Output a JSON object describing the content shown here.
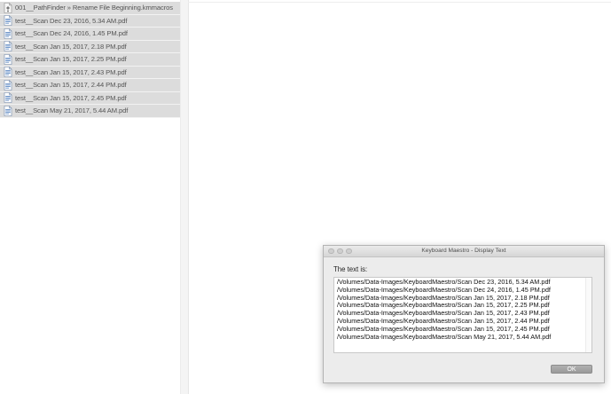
{
  "file_list": {
    "items": [
      {
        "name": "001__PathFinder » Rename File Beginning.kmmacros",
        "icon": "macro-file-icon"
      },
      {
        "name": "test__Scan Dec 23, 2016, 5.34 AM.pdf",
        "icon": "pdf-file-icon"
      },
      {
        "name": "test__Scan Dec 24, 2016, 1.45 PM.pdf",
        "icon": "pdf-file-icon"
      },
      {
        "name": "test__Scan Jan 15, 2017, 2.18 PM.pdf",
        "icon": "pdf-file-icon"
      },
      {
        "name": "test__Scan Jan 15, 2017, 2.25 PM.pdf",
        "icon": "pdf-file-icon"
      },
      {
        "name": "test__Scan Jan 15, 2017, 2.43 PM.pdf",
        "icon": "pdf-file-icon"
      },
      {
        "name": "test__Scan Jan 15, 2017, 2.44 PM.pdf",
        "icon": "pdf-file-icon"
      },
      {
        "name": "test__Scan Jan 15, 2017, 2.45 PM.pdf",
        "icon": "pdf-file-icon"
      },
      {
        "name": "test__Scan May 21, 2017, 5.44 AM.pdf",
        "icon": "pdf-file-icon"
      }
    ]
  },
  "dialog": {
    "title": "Keyboard Maestro - Display Text",
    "prompt": "The text is:",
    "lines": [
      "/Volumes/Data-Images/KeyboardMaestro/Scan Dec 23, 2016, 5.34 AM.pdf",
      "/Volumes/Data-Images/KeyboardMaestro/Scan Dec 24, 2016, 1.45 PM.pdf",
      "/Volumes/Data-Images/KeyboardMaestro/Scan Jan 15, 2017, 2.18 PM.pdf",
      "/Volumes/Data-Images/KeyboardMaestro/Scan Jan 15, 2017, 2.25 PM.pdf",
      "/Volumes/Data-Images/KeyboardMaestro/Scan Jan 15, 2017, 2.43 PM.pdf",
      "/Volumes/Data-Images/KeyboardMaestro/Scan Jan 15, 2017, 2.44 PM.pdf",
      "/Volumes/Data-Images/KeyboardMaestro/Scan Jan 15, 2017, 2.45 PM.pdf",
      "/Volumes/Data-Images/KeyboardMaestro/Scan May 21, 2017, 5.44 AM.pdf"
    ],
    "ok_label": "OK"
  },
  "colors": {
    "row_selected_bg": "#dcdcdc",
    "pdf_icon_blue": "#3b6fb6",
    "ok_button_gray": "#a6a6a6"
  }
}
